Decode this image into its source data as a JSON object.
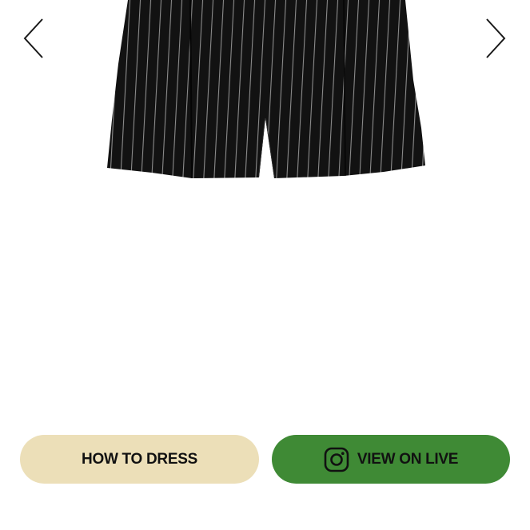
{
  "product": {
    "image_icon": "pinstripe-shorts-image"
  },
  "carousel": {
    "prev_icon": "chevron-left-icon",
    "next_icon": "chevron-right-icon"
  },
  "actions": {
    "how_to_dress_label": "HOW TO DRESS",
    "view_on_live_label": "VIEW ON LIVE",
    "live_icon": "instagram-icon"
  },
  "colors": {
    "how_to_dress_bg": "#ecdfb8",
    "view_on_live_bg": "#3f8a35",
    "garment": "#121212",
    "pinstripe": "#8c8c8c"
  }
}
